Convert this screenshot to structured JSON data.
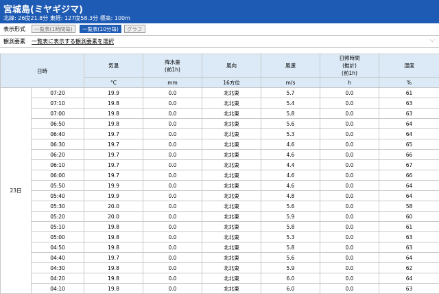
{
  "station": {
    "name": "宮城島(ミヤギジマ)",
    "location": "北緯: 26度21.8分 東経: 127度58.3分 標高: 100m"
  },
  "display_format": {
    "label": "表示形式",
    "buttons": [
      {
        "label": "一覧表(1時間毎)",
        "active": false
      },
      {
        "label": "一覧表(10分毎)",
        "active": true
      },
      {
        "label": "グラフ",
        "active": false
      }
    ]
  },
  "observation_elements": {
    "label": "観測要素",
    "select_text": "一覧表に表示する観測要素を選択"
  },
  "table": {
    "date_header": "日時",
    "columns": [
      {
        "name": "気温",
        "unit": "°C"
      },
      {
        "name": "降水量\n(前1h)",
        "unit": "mm"
      },
      {
        "name": "風向",
        "unit": "16方位"
      },
      {
        "name": "風速",
        "unit": "m/s"
      },
      {
        "name": "日照時間\n(推計)\n(前1h)",
        "unit": "h"
      },
      {
        "name": "湿度",
        "unit": "%"
      }
    ],
    "day": "23日",
    "rows": [
      {
        "time": "07:20",
        "temp": "19.9",
        "precip": "0.0",
        "dir": "北北東",
        "speed": "5.7",
        "sun": "0.0",
        "hum": "61"
      },
      {
        "time": "07:10",
        "temp": "19.8",
        "precip": "0.0",
        "dir": "北北東",
        "speed": "5.4",
        "sun": "0.0",
        "hum": "63"
      },
      {
        "time": "07:00",
        "temp": "19.8",
        "precip": "0.0",
        "dir": "北北東",
        "speed": "5.8",
        "sun": "0.0",
        "hum": "63"
      },
      {
        "time": "06:50",
        "temp": "19.8",
        "precip": "0.0",
        "dir": "北北東",
        "speed": "5.6",
        "sun": "0.0",
        "hum": "64"
      },
      {
        "time": "06:40",
        "temp": "19.7",
        "precip": "0.0",
        "dir": "北北東",
        "speed": "5.3",
        "sun": "0.0",
        "hum": "64"
      },
      {
        "time": "06:30",
        "temp": "19.7",
        "precip": "0.0",
        "dir": "北北東",
        "speed": "4.6",
        "sun": "0.0",
        "hum": "65"
      },
      {
        "time": "06:20",
        "temp": "19.7",
        "precip": "0.0",
        "dir": "北北東",
        "speed": "4.6",
        "sun": "0.0",
        "hum": "66"
      },
      {
        "time": "06:10",
        "temp": "19.7",
        "precip": "0.0",
        "dir": "北北東",
        "speed": "4.4",
        "sun": "0.0",
        "hum": "67"
      },
      {
        "time": "06:00",
        "temp": "19.7",
        "precip": "0.0",
        "dir": "北北東",
        "speed": "4.6",
        "sun": "0.0",
        "hum": "66"
      },
      {
        "time": "05:50",
        "temp": "19.9",
        "precip": "0.0",
        "dir": "北北東",
        "speed": "4.6",
        "sun": "0.0",
        "hum": "64"
      },
      {
        "time": "05:40",
        "temp": "19.9",
        "precip": "0.0",
        "dir": "北北東",
        "speed": "4.8",
        "sun": "0.0",
        "hum": "64"
      },
      {
        "time": "05:30",
        "temp": "20.0",
        "precip": "0.0",
        "dir": "北北東",
        "speed": "5.6",
        "sun": "0.0",
        "hum": "58"
      },
      {
        "time": "05:20",
        "temp": "20.0",
        "precip": "0.0",
        "dir": "北北東",
        "speed": "5.9",
        "sun": "0.0",
        "hum": "60"
      },
      {
        "time": "05:10",
        "temp": "19.8",
        "precip": "0.0",
        "dir": "北北東",
        "speed": "5.8",
        "sun": "0.0",
        "hum": "61"
      },
      {
        "time": "05:00",
        "temp": "19.8",
        "precip": "0.0",
        "dir": "北北東",
        "speed": "5.3",
        "sun": "0.0",
        "hum": "63"
      },
      {
        "time": "04:50",
        "temp": "19.8",
        "precip": "0.0",
        "dir": "北北東",
        "speed": "5.8",
        "sun": "0.0",
        "hum": "63"
      },
      {
        "time": "04:40",
        "temp": "19.7",
        "precip": "0.0",
        "dir": "北北東",
        "speed": "5.6",
        "sun": "0.0",
        "hum": "64"
      },
      {
        "time": "04:30",
        "temp": "19.8",
        "precip": "0.0",
        "dir": "北北東",
        "speed": "5.9",
        "sun": "0.0",
        "hum": "62"
      },
      {
        "time": "04:20",
        "temp": "19.8",
        "precip": "0.0",
        "dir": "北北東",
        "speed": "6.0",
        "sun": "0.0",
        "hum": "64"
      },
      {
        "time": "04:10",
        "temp": "19.8",
        "precip": "0.0",
        "dir": "北北東",
        "speed": "6.0",
        "sun": "0.0",
        "hum": "63"
      }
    ]
  }
}
